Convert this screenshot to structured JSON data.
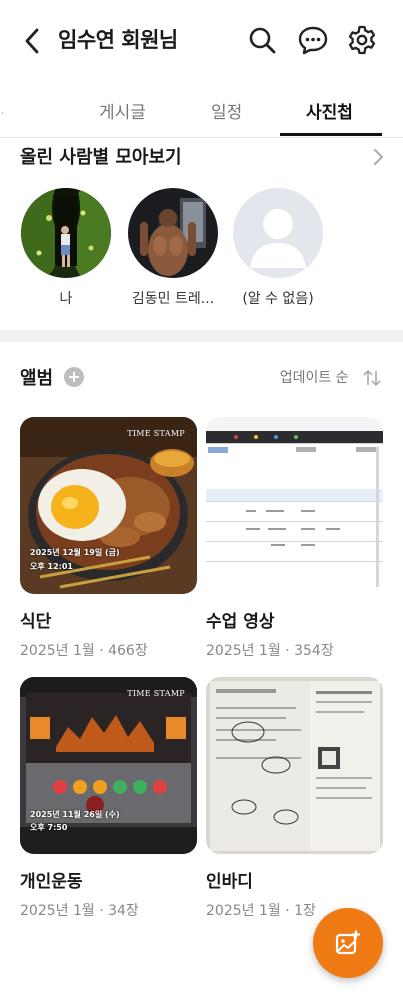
{
  "header": {
    "title": "임수연 회원님"
  },
  "tabs": [
    {
      "label": "홈"
    },
    {
      "label": "게시글"
    },
    {
      "label": "일정"
    },
    {
      "label": "사진첩"
    }
  ],
  "people_section": {
    "title": "올린 사람별 모아보기",
    "people": [
      {
        "name": "나"
      },
      {
        "name": "김동민 트레..."
      },
      {
        "name": "(알 수 없음)"
      }
    ]
  },
  "album_section": {
    "title": "앨범",
    "sort_label": "업데이트 순",
    "albums": [
      {
        "name": "식단",
        "meta": "2025년 1월 · 466장",
        "stamp_date": "2025년 12월 19일 (금)",
        "stamp_time": "오후 12:01",
        "stamp_brand": "TIME STAMP"
      },
      {
        "name": "수업 영상",
        "meta": "2025년 1월 · 354장"
      },
      {
        "name": "개인운동",
        "meta": "2025년 1월 · 34장",
        "stamp_date": "2025년 11월 26일 (수)",
        "stamp_time": "오후 7:50",
        "stamp_brand": "TIME STAMP"
      },
      {
        "name": "인바디",
        "meta": "2025년 1월 · 1장"
      }
    ]
  },
  "icons": {
    "back": "chevron-left-icon",
    "search": "search-icon",
    "chat": "chat-bubble-icon",
    "settings": "gear-icon",
    "more": "chevron-right-icon",
    "add": "plus-circle-icon",
    "sort": "sort-arrows-icon",
    "fab": "add-photo-icon"
  },
  "colors": {
    "accent": "#f07a14",
    "active_tab": "#111111",
    "muted_text": "#888888"
  }
}
